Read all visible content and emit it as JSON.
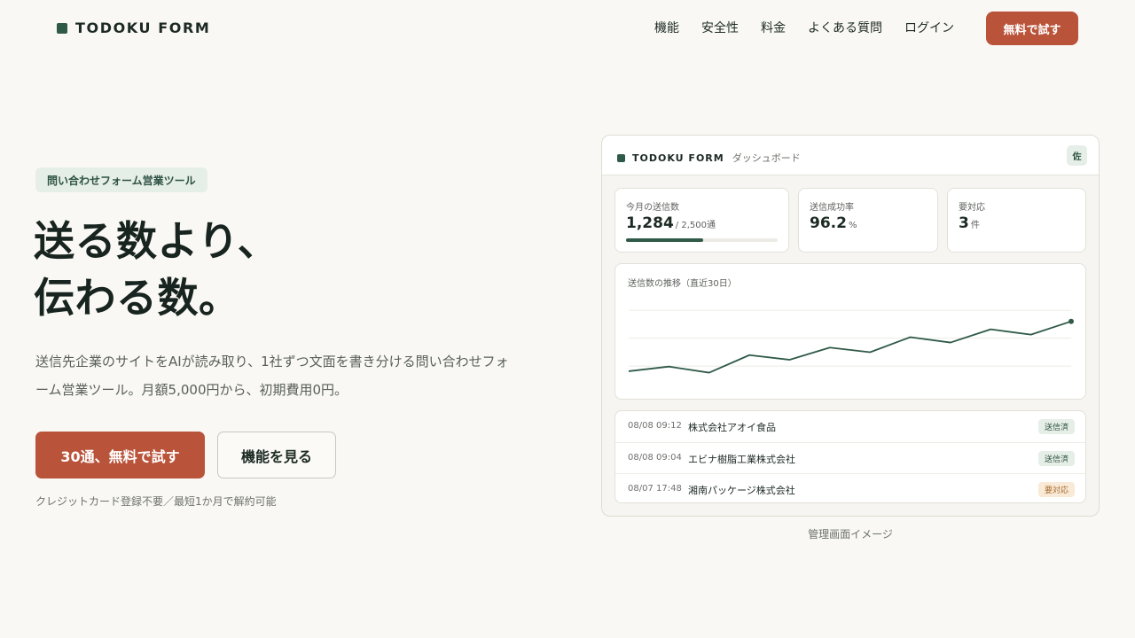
{
  "header": {
    "logo": "TODOKU FORM",
    "nav": [
      "機能",
      "安全性",
      "料金",
      "よくある質問",
      "ログイン"
    ],
    "cta": "無料で試す"
  },
  "hero": {
    "badge": "問い合わせフォーム営業ツール",
    "headline_line1": "送る数より、",
    "headline_line2": "伝わる数。",
    "lead": "送信先企業のサイトをAIが読み取り、1社ずつ文面を書き分ける問い合わせフォーム営業ツール。月額5,000円から、初期費用0円。",
    "primary_button": "30通、無料で試す",
    "secondary_button": "機能を見る",
    "note": "クレジットカード登録不要／最短1か月で解約可能"
  },
  "dashboard": {
    "logo": "TODOKU FORM",
    "subtitle": "ダッシュボード",
    "avatar": "佐",
    "stats": {
      "sent": {
        "label": "今月の送信数",
        "value": "1,284",
        "unit": "/ 2,500通",
        "progress": 0.51
      },
      "success": {
        "label": "送信成功率",
        "value": "96.2",
        "unit": "%"
      },
      "action": {
        "label": "要対応",
        "value": "3",
        "unit": "件"
      }
    },
    "chart_title": "送信数の推移（直近30日）",
    "rows": [
      {
        "time": "08/08 09:12",
        "company": "株式会社アオイ食品",
        "status": "送信済"
      },
      {
        "time": "08/08 09:04",
        "company": "エビナ樹脂工業株式会社",
        "status": "送信済"
      },
      {
        "time": "08/07 17:48",
        "company": "湘南パッケージ株式会社",
        "status": "要対応"
      }
    ],
    "caption": "管理画面イメージ"
  },
  "colors": {
    "accent": "#b9533a",
    "brand": "#2f5a48",
    "background": "#f9f8f4"
  },
  "chart_data": {
    "type": "line",
    "title": "送信数の推移（直近30日）",
    "x": [
      1,
      2,
      3,
      4,
      5,
      6,
      7,
      8,
      9,
      10,
      11,
      12
    ],
    "series": [
      {
        "values": [
          0.0,
          0.13,
          -0.04,
          0.45,
          0.32,
          0.66,
          0.53,
          0.95,
          0.8,
          1.17,
          1.02,
          1.39
        ]
      }
    ],
    "ylim": [
      -0.1,
      2.0
    ],
    "grid": true
  }
}
